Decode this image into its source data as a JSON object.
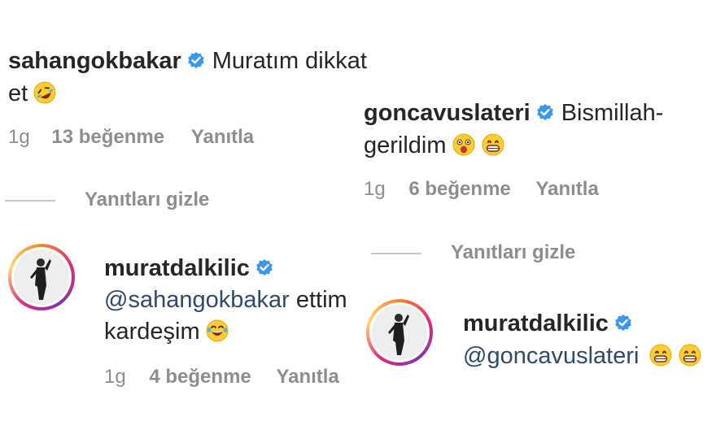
{
  "comment1": {
    "username": "sahangokbakar",
    "text_line1": "Muratım dikkat",
    "text_line2": "et",
    "emoji": "rofl-emoji",
    "time": "1g",
    "likes": "13 beğenme",
    "reply": "Yanıtla",
    "hide_replies": "Yanıtları gizle"
  },
  "reply1": {
    "username": "muratdalkilic",
    "mention": "@sahangokbakar",
    "text_line1": " ettim",
    "text_line2": "kardeşim",
    "emoji": "tears-of-joy-emoji",
    "time": "1g",
    "likes": "4 beğenme",
    "reply": "Yanıtla"
  },
  "comment2": {
    "username": "goncavuslateri",
    "text_line1": "Bismillah-",
    "text_line2": "gerildim",
    "emojis": [
      "astonished-emoji",
      "grinning-emoji"
    ],
    "time": "1g",
    "likes": "6 beğenme",
    "reply": "Yanıtla",
    "hide_replies": "Yanıtları gizle"
  },
  "reply2": {
    "username": "muratdalkilic",
    "mention": "@goncavuslateri",
    "emojis": [
      "grinning-emoji",
      "grinning-emoji"
    ]
  },
  "colors": {
    "verified_badge": "#3897f0",
    "mention": "#2f4a6d",
    "meta_gray": "#8e8e8e"
  }
}
